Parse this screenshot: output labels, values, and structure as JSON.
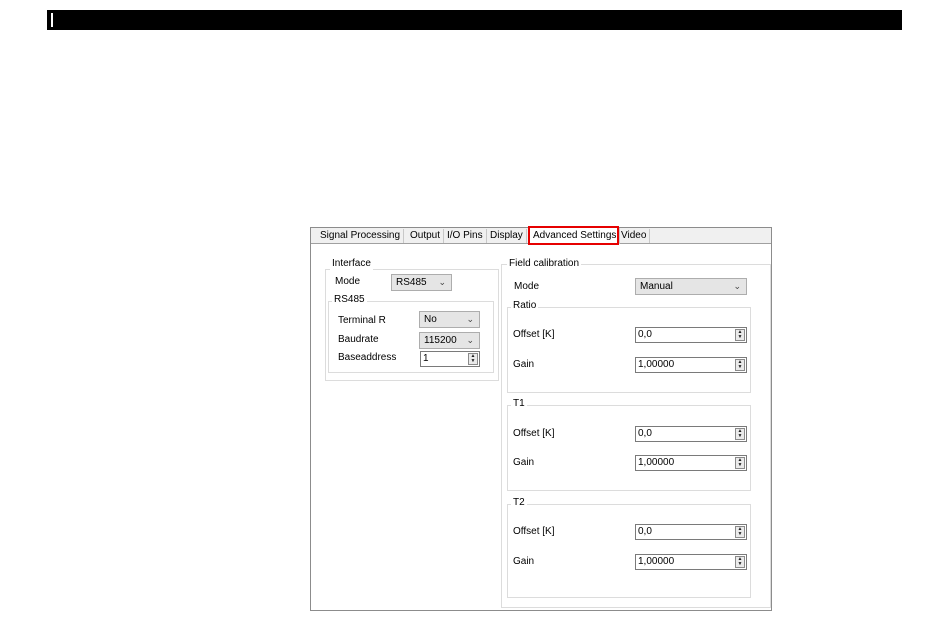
{
  "tabs": [
    {
      "label": "Signal Processing"
    },
    {
      "label": "Output"
    },
    {
      "label": "I/O Pins"
    },
    {
      "label": "Display"
    },
    {
      "label": "Advanced Settings"
    },
    {
      "label": "Video"
    }
  ],
  "highlight_color": "#e60000",
  "interface": {
    "title": "Interface",
    "mode_label": "Mode",
    "mode_value": "RS485",
    "rs485": {
      "title": "RS485",
      "terminal_r_label": "Terminal R",
      "terminal_r_value": "No",
      "baudrate_label": "Baudrate",
      "baudrate_value": "115200",
      "baseaddress_label": "Baseaddress",
      "baseaddress_value": "1"
    }
  },
  "field_calibration": {
    "title": "Field calibration",
    "mode_label": "Mode",
    "mode_value": "Manual",
    "groups": [
      {
        "title": "Ratio",
        "offset_label": "Offset [K]",
        "offset_value": "0,0",
        "gain_label": "Gain",
        "gain_value": "1,00000"
      },
      {
        "title": "T1",
        "offset_label": "Offset [K]",
        "offset_value": "0,0",
        "gain_label": "Gain",
        "gain_value": "1,00000"
      },
      {
        "title": "T2",
        "offset_label": "Offset [K]",
        "offset_value": "0,0",
        "gain_label": "Gain",
        "gain_value": "1,00000"
      }
    ]
  },
  "icons": {
    "dropdown": "chevron-down-icon",
    "spinner": "spinner-arrows-icon"
  }
}
